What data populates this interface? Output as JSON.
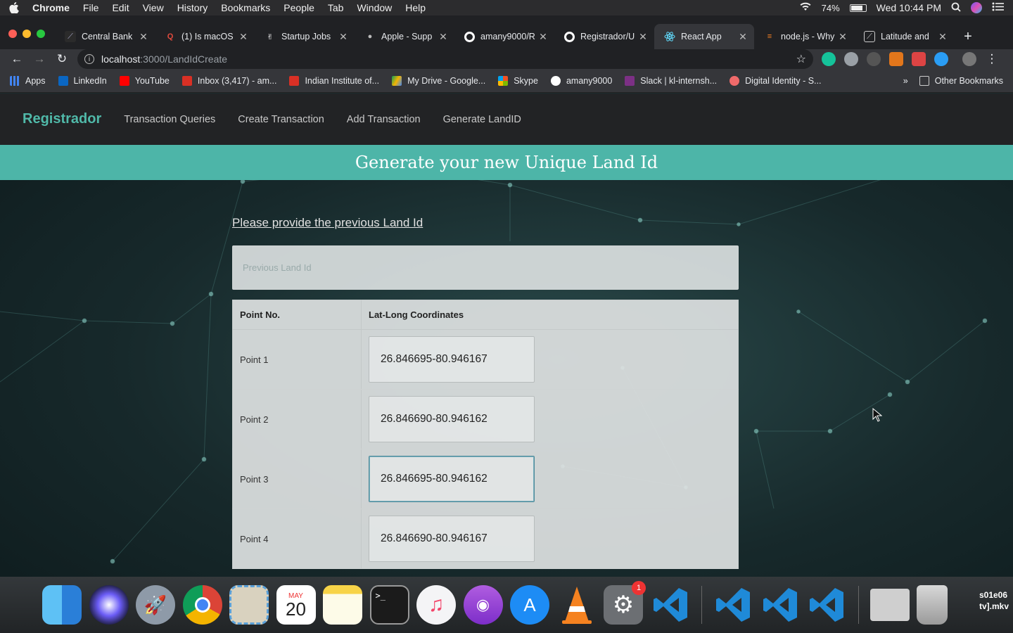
{
  "menubar": {
    "app": "Chrome",
    "items": [
      "File",
      "Edit",
      "View",
      "History",
      "Bookmarks",
      "People",
      "Tab",
      "Window",
      "Help"
    ],
    "battery": "74%",
    "clock": "Wed 10:44 PM"
  },
  "tabs": [
    {
      "title": "Central Bank",
      "icon": "central-bank-icon"
    },
    {
      "title": "(1) Is macOS",
      "icon": "quora-icon"
    },
    {
      "title": "Startup Jobs",
      "icon": "angellist-icon"
    },
    {
      "title": "Apple - Supp",
      "icon": "apple-icon"
    },
    {
      "title": "amany9000/R",
      "icon": "github-icon"
    },
    {
      "title": "Registrador/U",
      "icon": "github-icon"
    },
    {
      "title": "React App",
      "icon": "react-icon",
      "active": true
    },
    {
      "title": "node.js - Why",
      "icon": "stackoverflow-icon"
    },
    {
      "title": "Latitude and",
      "icon": "map-icon"
    }
  ],
  "omnibox": {
    "host": "localhost",
    "path": ":3000/LandIdCreate"
  },
  "bookmarks": [
    "Apps",
    "LinkedIn",
    "YouTube",
    "Inbox (3,417) - am...",
    "Indian Institute of...",
    "My Drive - Google...",
    "Skype",
    "amany9000",
    "Slack | kl-internsh...",
    "Digital Identity - S..."
  ],
  "bookmarks_other": "Other Bookmarks",
  "app": {
    "brand": "Registrador",
    "nav": [
      "Transaction Queries",
      "Create Transaction",
      "Add Transaction",
      "Generate LandID"
    ],
    "banner": "Generate your new Unique Land Id",
    "prompt": "Please provide the previous Land Id",
    "prev_placeholder": "Previous Land Id",
    "table": {
      "headers": [
        "Point No.",
        "Lat-Long Coordinates"
      ],
      "rows": [
        {
          "point": "Point 1",
          "coord": "26.846695-80.946167"
        },
        {
          "point": "Point 2",
          "coord": "26.846690-80.946162"
        },
        {
          "point": "Point 3",
          "coord": "26.846695-80.946162"
        },
        {
          "point": "Point 4",
          "coord": "26.846690-80.946167"
        }
      ]
    }
  },
  "dock": {
    "calendar_month": "MAY",
    "calendar_day": "20",
    "prefs_badge": "1",
    "file_label_1": "s01e06",
    "file_label_2": "tv].mkv"
  }
}
